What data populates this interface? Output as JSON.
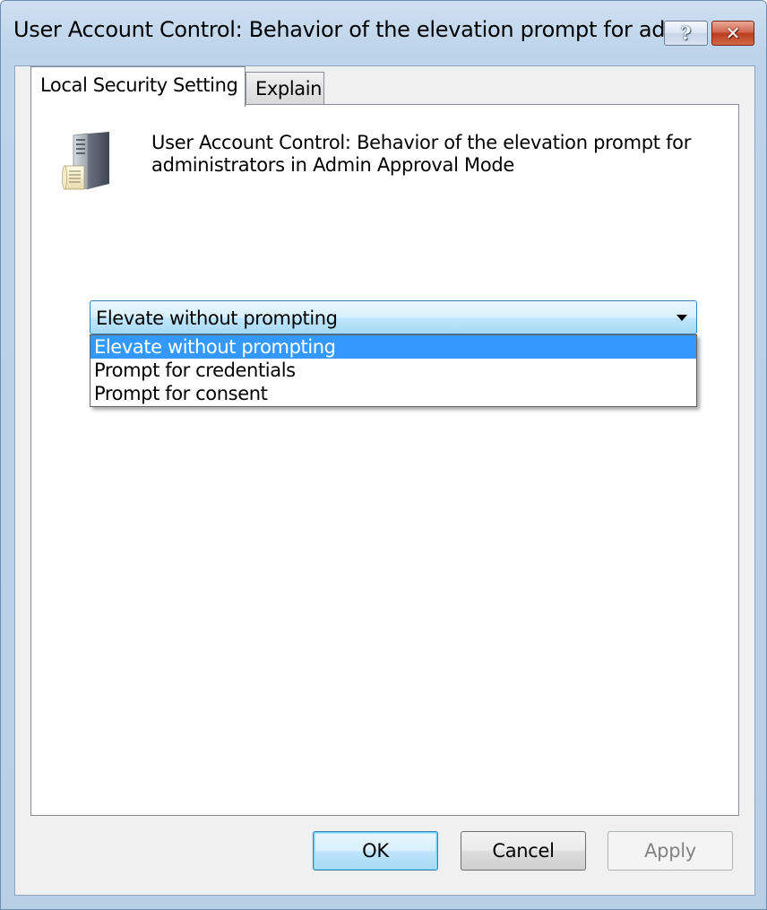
{
  "window": {
    "title": "User Account Control: Behavior of the elevation prompt for adm...",
    "help_glyph": "?",
    "close_glyph": "✕"
  },
  "tabs": [
    {
      "label": "Local Security Setting",
      "active": true
    },
    {
      "label": "Explain",
      "active": false
    }
  ],
  "policy": {
    "icon": "server-policy-icon",
    "title": "User Account Control: Behavior of the elevation prompt for administrators in Admin Approval Mode"
  },
  "combo": {
    "selected_value": "Elevate without prompting",
    "options": [
      "Elevate without prompting",
      "Prompt for credentials",
      "Prompt for consent"
    ],
    "highlighted_index": 0
  },
  "buttons": {
    "ok": "OK",
    "cancel": "Cancel",
    "apply": "Apply"
  },
  "colors": {
    "selection": "#3399ff",
    "combo_border": "#3c7fb1",
    "close_red": "#bb3e20"
  }
}
